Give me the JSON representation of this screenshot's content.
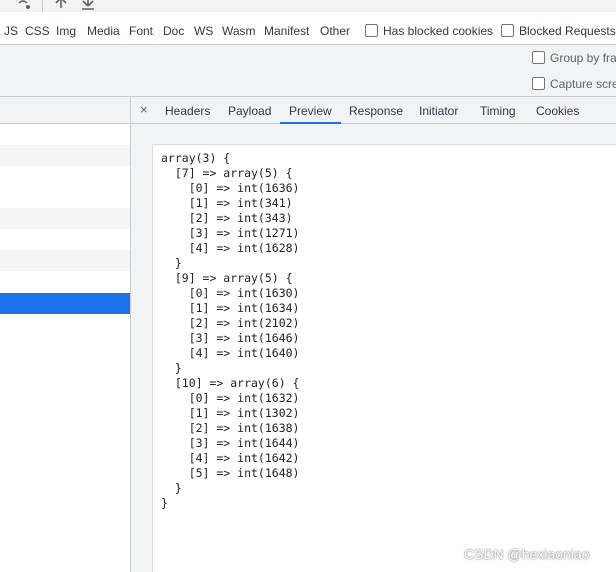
{
  "toolbar": {
    "icons": [
      "wifi-throttle-icon",
      "upload-icon",
      "download-icon"
    ]
  },
  "filters": {
    "types": [
      "JS",
      "CSS",
      "Img",
      "Media",
      "Font",
      "Doc",
      "WS",
      "Wasm",
      "Manifest",
      "Other"
    ],
    "has_blocked_cookies": "Has blocked cookies",
    "blocked_requests": "Blocked Requests"
  },
  "settings": {
    "group_by_frame": "Group by fra",
    "capture_screenshots": "Capture scre"
  },
  "detail": {
    "close_symbol": "×",
    "tabs": [
      "Headers",
      "Payload",
      "Preview",
      "Response",
      "Initiator",
      "Timing",
      "Cookies"
    ],
    "active_tab": "Preview",
    "preview_lines": [
      "array(3) {",
      "  [7] => array(5) {",
      "    [0] => int(1636)",
      "    [1] => int(341)",
      "    [2] => int(343)",
      "    [3] => int(1271)",
      "    [4] => int(1628)",
      "  }",
      "  [9] => array(5) {",
      "    [0] => int(1630)",
      "    [1] => int(1634)",
      "    [2] => int(2102)",
      "    [3] => int(1646)",
      "    [4] => int(1640)",
      "  }",
      "  [10] => array(6) {",
      "    [0] => int(1632)",
      "    [1] => int(1302)",
      "    [2] => int(1638)",
      "    [3] => int(1644)",
      "    [4] => int(1642)",
      "    [5] => int(1648)",
      "  }",
      "}"
    ]
  },
  "watermark": "CSDN @hexiaoniao",
  "colors": {
    "accent": "#1a73e8",
    "selected_row": "#1a73e8",
    "panel_bg": "#f1f3f4",
    "border": "#cbcdd1"
  }
}
